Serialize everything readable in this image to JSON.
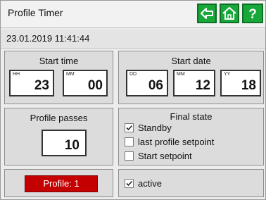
{
  "header": {
    "title": "Profile Timer",
    "buttons": [
      {
        "icon": "back-arrow-icon"
      },
      {
        "icon": "home-icon"
      },
      {
        "icon": "help-icon",
        "label": "?"
      }
    ]
  },
  "datetime": "23.01.2019 11:41:44",
  "start_time": {
    "title": "Start time",
    "hours": {
      "tag": "HH",
      "value": "23"
    },
    "minutes": {
      "tag": "MM",
      "value": "00"
    }
  },
  "start_date": {
    "title": "Start date",
    "day": {
      "tag": "DD",
      "value": "06"
    },
    "month": {
      "tag": "MM",
      "value": "12"
    },
    "year": {
      "tag": "YY",
      "value": "18"
    }
  },
  "profile_passes": {
    "title": "Profile passes",
    "value": "10"
  },
  "final_state": {
    "title": "Final state",
    "options": [
      {
        "label": "Standby",
        "checked": true
      },
      {
        "label": "last profile setpoint",
        "checked": false
      },
      {
        "label": "Start setpoint",
        "checked": false
      }
    ]
  },
  "profile": {
    "label": "Profile: 1"
  },
  "active": {
    "label": "active",
    "checked": true
  },
  "colors": {
    "nav_button": "#18a83a",
    "profile_badge": "#c40000"
  }
}
